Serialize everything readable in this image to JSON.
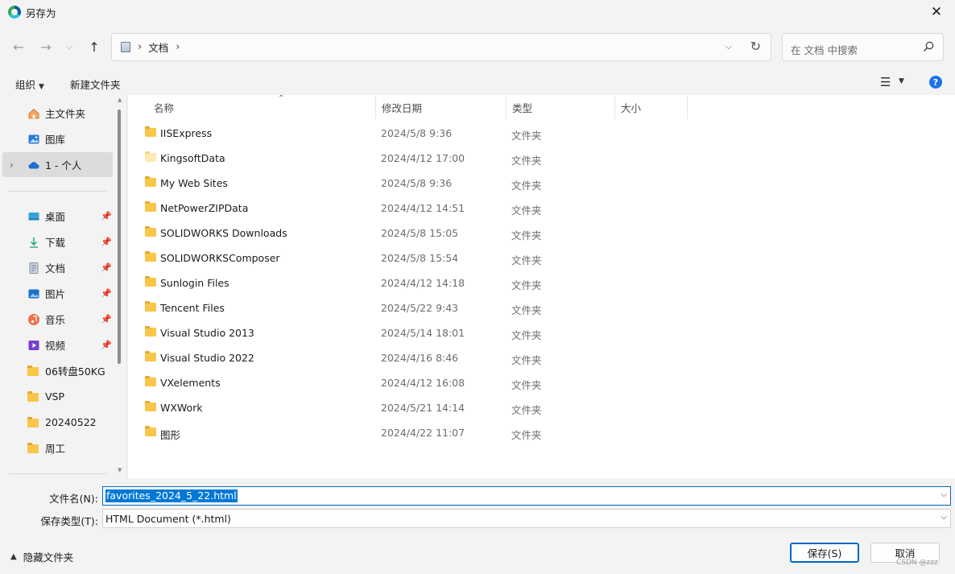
{
  "window": {
    "title": "另存为"
  },
  "nav": {
    "breadcrumb": [
      "文档"
    ],
    "search_placeholder": "在 文档 中搜索"
  },
  "toolbar": {
    "organize": "组织",
    "new_folder": "新建文件夹"
  },
  "sidebar": {
    "top": [
      {
        "label": "主文件夹",
        "icon": "home-icon"
      },
      {
        "label": "图库",
        "icon": "gallery-icon"
      },
      {
        "label": "1 - 个人",
        "icon": "onedrive-icon",
        "selected": true
      }
    ],
    "pinned": [
      {
        "label": "桌面",
        "icon": "desktop-icon",
        "pinned": true
      },
      {
        "label": "下载",
        "icon": "download-icon",
        "pinned": true
      },
      {
        "label": "文档",
        "icon": "documents-icon",
        "pinned": true
      },
      {
        "label": "图片",
        "icon": "pictures-icon",
        "pinned": true
      },
      {
        "label": "音乐",
        "icon": "music-icon",
        "pinned": true
      },
      {
        "label": "视频",
        "icon": "videos-icon",
        "pinned": true
      },
      {
        "label": "06转盘50KG",
        "icon": "folder-icon"
      },
      {
        "label": "VSP",
        "icon": "folder-icon"
      },
      {
        "label": "20240522",
        "icon": "folder-icon"
      },
      {
        "label": "周工",
        "icon": "folder-icon"
      }
    ]
  },
  "columns": [
    "名称",
    "修改日期",
    "类型",
    "大小"
  ],
  "files": [
    {
      "name": "IISExpress",
      "date": "2024/5/8 9:36",
      "type": "文件夹"
    },
    {
      "name": "KingsoftData",
      "date": "2024/4/12 17:00",
      "type": "文件夹",
      "light": true
    },
    {
      "name": "My Web Sites",
      "date": "2024/5/8 9:36",
      "type": "文件夹"
    },
    {
      "name": "NetPowerZIPData",
      "date": "2024/4/12 14:51",
      "type": "文件夹"
    },
    {
      "name": "SOLIDWORKS Downloads",
      "date": "2024/5/8 15:05",
      "type": "文件夹"
    },
    {
      "name": "SOLIDWORKSComposer",
      "date": "2024/5/8 15:54",
      "type": "文件夹"
    },
    {
      "name": "Sunlogin Files",
      "date": "2024/4/12 14:18",
      "type": "文件夹"
    },
    {
      "name": "Tencent Files",
      "date": "2024/5/22 9:43",
      "type": "文件夹"
    },
    {
      "name": "Visual Studio 2013",
      "date": "2024/5/14 18:01",
      "type": "文件夹"
    },
    {
      "name": "Visual Studio 2022",
      "date": "2024/4/16 8:46",
      "type": "文件夹"
    },
    {
      "name": "VXelements",
      "date": "2024/4/12 16:08",
      "type": "文件夹"
    },
    {
      "name": "WXWork",
      "date": "2024/5/21 14:14",
      "type": "文件夹"
    },
    {
      "name": "图形",
      "date": "2024/4/22 11:07",
      "type": "文件夹"
    }
  ],
  "form": {
    "filename_label": "文件名(N):",
    "filename_value": "favorites_2024_5_22.html",
    "filetype_label": "保存类型(T):",
    "filetype_value": "HTML Document (*.html)"
  },
  "footer": {
    "hide_folders": "隐藏文件夹",
    "save": "保存(S)",
    "cancel": "取消",
    "watermark": "CSDN @zzz"
  },
  "colors": {
    "accent": "#0067c0",
    "selection": "#0078d7",
    "folder": "#f8c74a"
  }
}
